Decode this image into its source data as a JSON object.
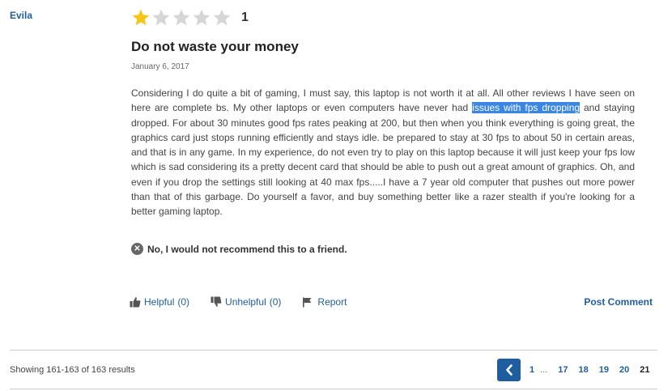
{
  "review": {
    "reviewer": "Evila",
    "rating": 1,
    "rating_display": "1",
    "max_rating": 5,
    "title": "Do not waste your money",
    "date": "January 6, 2017",
    "body_before": "Considering I do quite a bit of gaming, I must say, this laptop is not worth it at all. All other reviews I have seen on here are complete bs. My other laptops or even computers have never had ",
    "body_highlight": "issues with fps dropping",
    "body_after": " and staying dropped. For about 30 minutes good fps rates peaking at 200, but then when you think everything is going great, the graphics card just stops running efficiently and stays idle. be prepared to stay at 30 fps to about 50 in certain areas, and that is in any game. In my experience, do not even try to play on this laptop because it will just keep your fps low which is sad considering its a pretty decent card that should be able to push out a great amount of graphics. Oh, and even if you drop the settings still looking at 40 max fps.....I have a 7 year old computer that pushes out more power than that of this garbage. Do yourself a favor, and buy something better like a razer stealth if you're looking for a better gaming laptop.",
    "recommend_text": "No, I would not recommend this to a friend."
  },
  "actions": {
    "helpful_label": "Helpful",
    "helpful_count": "(0)",
    "unhelpful_label": "Unhelpful",
    "unhelpful_count": "(0)",
    "report_label": "Report",
    "post_comment_label": "Post Comment"
  },
  "pagination": {
    "showing_text": "Showing 161-163 of 163 results",
    "pages": [
      "1",
      "...",
      "17",
      "18",
      "19",
      "20",
      "21"
    ],
    "current_page": "21"
  },
  "colors": {
    "link": "#1f5e9e",
    "star_filled": "#f5c518",
    "star_empty": "#d6d6d6",
    "highlight": "#3b86e0"
  },
  "icons": {
    "star_filled": "star-filled-icon",
    "star_empty": "star-empty-icon",
    "no_recommend": "x-circle-icon",
    "helpful": "thumbs-up-icon",
    "unhelpful": "thumbs-down-icon",
    "report": "flag-icon",
    "prev": "chevron-left-icon"
  }
}
